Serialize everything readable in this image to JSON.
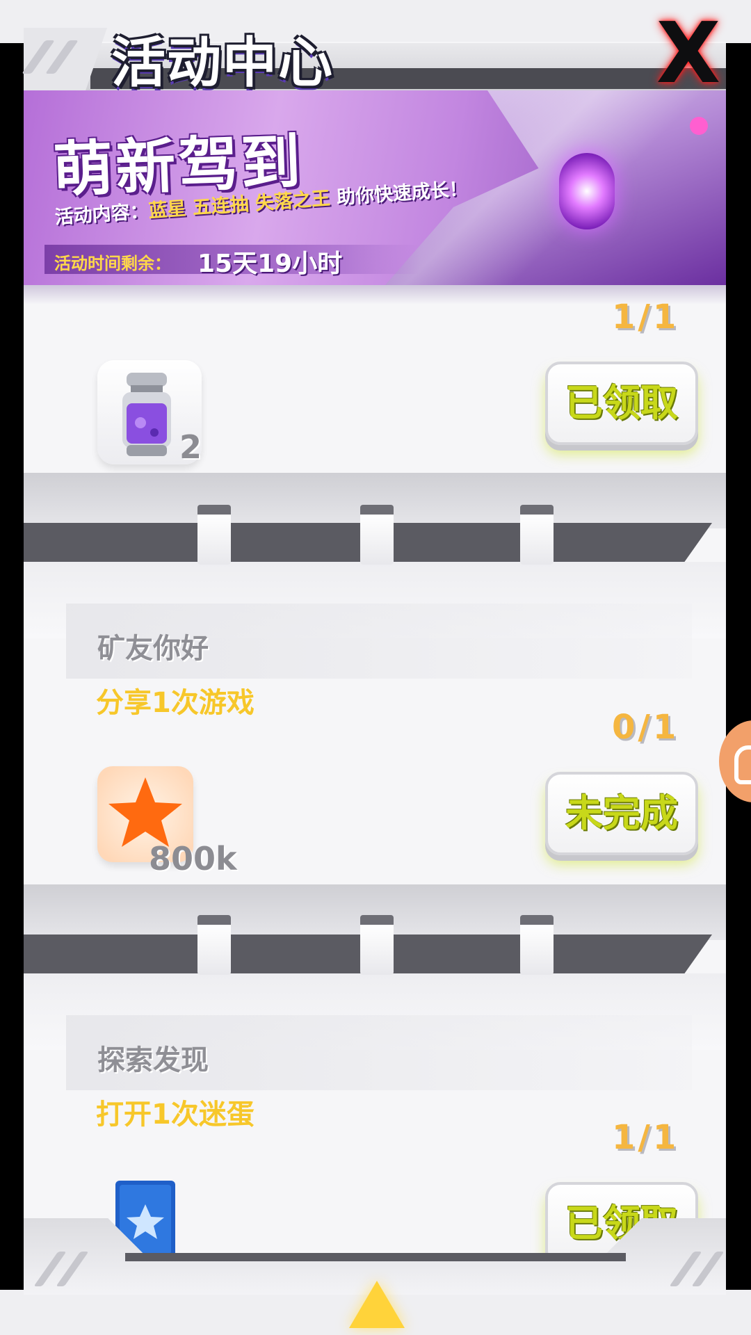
{
  "header": {
    "title": "活动中心",
    "close_label": "X"
  },
  "banner": {
    "title": "萌新驾到",
    "desc_prefix": "活动内容：",
    "desc_items": [
      "蓝星",
      "五连抽",
      "失落之王"
    ],
    "desc_suffix": "助你快速成长！",
    "timer_label": "活动时间剩余：",
    "timer_value": "15天19小时"
  },
  "tasks": [
    {
      "title": "",
      "progress": "1/1",
      "reward_icon": "purple-potion-icon",
      "reward_count": "2",
      "button_label": "已领取"
    },
    {
      "title": "矿友你好",
      "description": "分享1次游戏",
      "progress": "0/1",
      "reward_icon": "orange-star-icon",
      "reward_count": "800k",
      "button_label": "未完成"
    },
    {
      "title": "探索发现",
      "description": "打开1次迷蛋",
      "progress": "1/1",
      "reward_icon": "blue-star-card-icon",
      "reward_count": "",
      "button_label": "已领取"
    }
  ],
  "colors": {
    "accent_yellow": "#f7c72a",
    "progress_orange": "#f5b640",
    "button_text": "#c8d81a",
    "banner_purple": "#b56fd8"
  }
}
